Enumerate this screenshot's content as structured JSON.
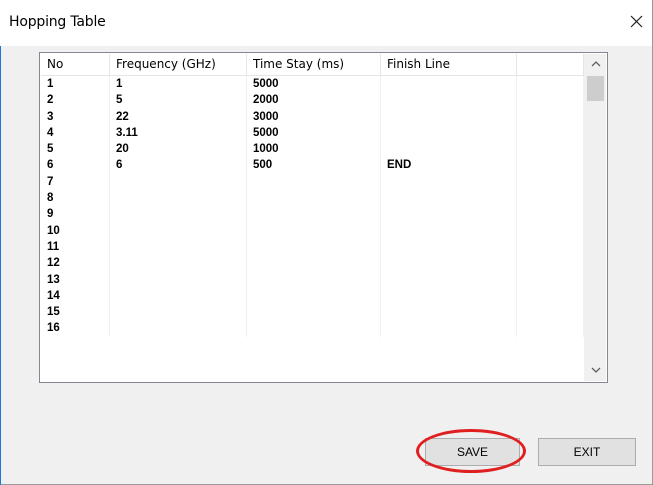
{
  "window": {
    "title": "Hopping Table"
  },
  "table": {
    "columns": [
      "No",
      "Frequency (GHz)",
      "Time Stay (ms)",
      "Finish Line",
      ""
    ],
    "rows": [
      [
        "1",
        "1",
        "5000",
        ""
      ],
      [
        "2",
        "5",
        "2000",
        ""
      ],
      [
        "3",
        "22",
        "3000",
        ""
      ],
      [
        "4",
        "3.11",
        "5000",
        ""
      ],
      [
        "5",
        "20",
        "1000",
        ""
      ],
      [
        "6",
        "6",
        "500",
        "END"
      ],
      [
        "7",
        "",
        "",
        ""
      ],
      [
        "8",
        "",
        "",
        ""
      ],
      [
        "9",
        "",
        "",
        ""
      ],
      [
        "10",
        "",
        "",
        ""
      ],
      [
        "11",
        "",
        "",
        ""
      ],
      [
        "12",
        "",
        "",
        ""
      ],
      [
        "13",
        "",
        "",
        ""
      ],
      [
        "14",
        "",
        "",
        ""
      ],
      [
        "15",
        "",
        "",
        ""
      ],
      [
        "16",
        "",
        "",
        ""
      ]
    ]
  },
  "scrollbar": {
    "up_glyph": "^",
    "down_glyph": "v"
  },
  "buttons": {
    "save": "SAVE",
    "exit": "EXIT"
  },
  "colors": {
    "highlight": "#e02020",
    "accent_edge": "#1e78d7"
  }
}
